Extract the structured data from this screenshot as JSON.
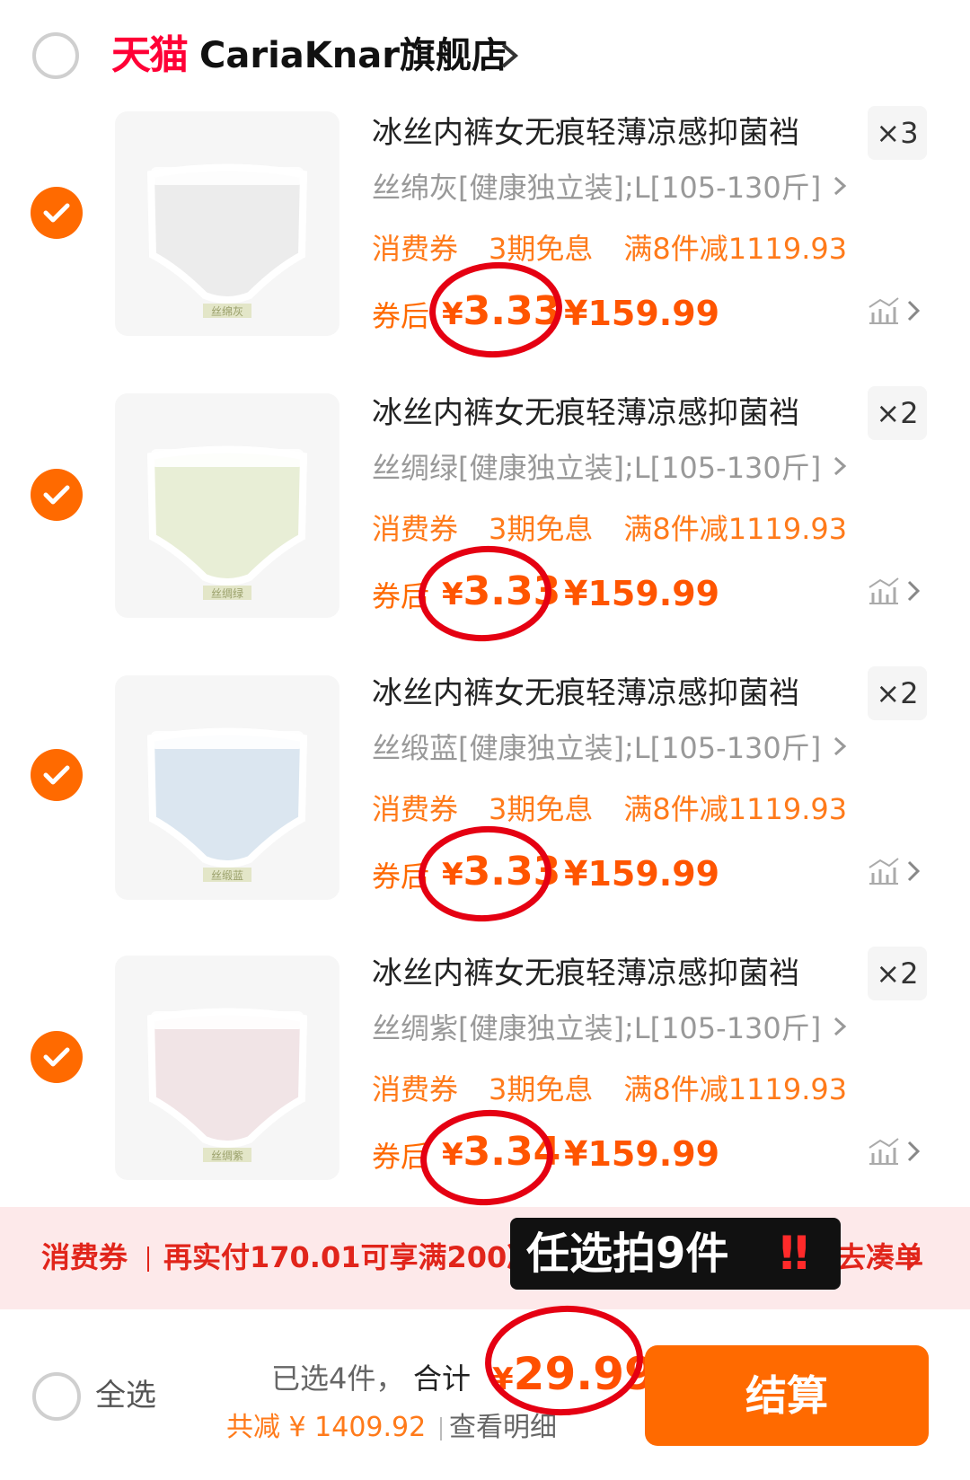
{
  "store": {
    "brand_logo": "天猫",
    "name": "CariaKnar旗舰店"
  },
  "items": [
    {
      "title": "冰丝内裤女无痕轻薄凉感抑菌裆",
      "qty": "×3",
      "sku": "丝绵灰[健康独立装];L[105-130斤]",
      "promos": [
        "消费券",
        "3期免息",
        "满8件减1119.93"
      ],
      "after_label": "券后",
      "after_price_yen": "¥",
      "after_price": "3.33",
      "orig_price": "¥159.99",
      "thumb_tag": "丝绵灰",
      "thumb_color": "#ececec"
    },
    {
      "title": "冰丝内裤女无痕轻薄凉感抑菌裆",
      "qty": "×2",
      "sku": "丝绸绿[健康独立装];L[105-130斤]",
      "promos": [
        "消费券",
        "3期免息",
        "满8件减1119.93"
      ],
      "after_label": "券后",
      "after_price_yen": "¥",
      "after_price": "3.33",
      "orig_price": "¥159.99",
      "thumb_tag": "丝绸绿",
      "thumb_color": "#e8eed6"
    },
    {
      "title": "冰丝内裤女无痕轻薄凉感抑菌裆",
      "qty": "×2",
      "sku": "丝缎蓝[健康独立装];L[105-130斤]",
      "promos": [
        "消费券",
        "3期免息",
        "满8件减1119.93"
      ],
      "after_label": "券后",
      "after_price_yen": "¥",
      "after_price": "3.33",
      "orig_price": "¥159.99",
      "thumb_tag": "丝缎蓝",
      "thumb_color": "#dbe6f0"
    },
    {
      "title": "冰丝内裤女无痕轻薄凉感抑菌裆",
      "qty": "×2",
      "sku": "丝绸紫[健康独立装];L[105-130斤]",
      "promos": [
        "消费券",
        "3期免息",
        "满8件减1119.93"
      ],
      "after_label": "券后",
      "after_price_yen": "¥",
      "after_price": "3.34",
      "orig_price": "¥159.99",
      "thumb_tag": "丝绸紫",
      "thumb_color": "#f1e4e6"
    }
  ],
  "coupon_bar": {
    "label": "消费券",
    "text": "再实付170.01可享满200减",
    "link": "去凑单"
  },
  "overlay": {
    "text": "任选拍9件",
    "bang": "‼"
  },
  "footer": {
    "select_all": "全选",
    "selected": "已选4件，",
    "total_label": "合计",
    "total_yen": "¥",
    "total": "29.99",
    "discount": "共减 ¥ 1409.92",
    "detail": "查看明细",
    "checkout": "结算"
  },
  "colors": {
    "accent": "#ff6a00",
    "price": "#ff5500",
    "coupon_bg": "#fde9ea",
    "coupon_text": "#e1251b",
    "annotation": "#e50012"
  },
  "icons": {
    "check": "check-icon",
    "chevron": "chevron-right-icon",
    "trend": "price-trend-icon"
  }
}
